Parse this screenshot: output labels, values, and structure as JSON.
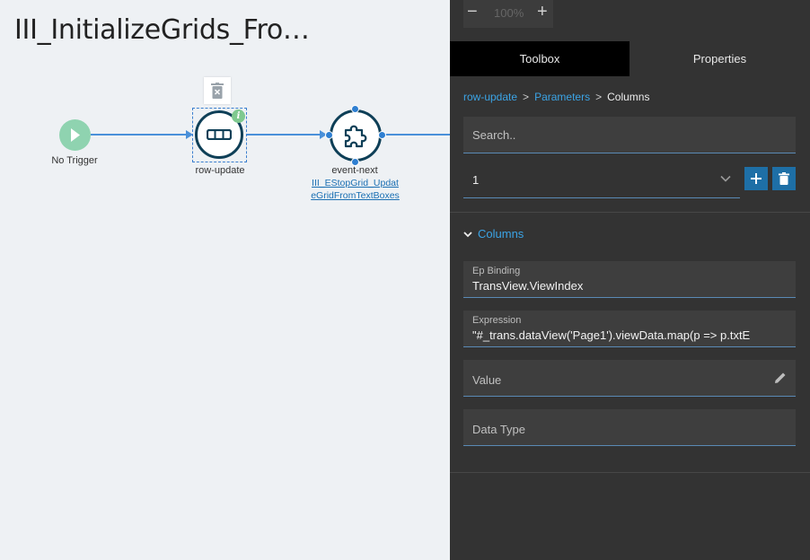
{
  "canvas": {
    "flow_title": "III_InitializeGrids_Fro…",
    "nodes": {
      "trigger_label": "No Trigger",
      "row_update_label": "row-update",
      "event_next_label": "event-next",
      "event_next_link": "III_EStopGrid_UpdateGridFromTextBoxes"
    }
  },
  "panel": {
    "zoom": {
      "minus": "−",
      "value": "100%",
      "plus": "+"
    },
    "tabs": [
      {
        "label": "Toolbox",
        "active": true
      },
      {
        "label": "Properties",
        "active": false
      }
    ],
    "breadcrumb": {
      "item1": "row-update",
      "item2": "Parameters",
      "current": "Columns",
      "separator": ">"
    },
    "search": {
      "placeholder": "Search.."
    },
    "selector": {
      "value": "1"
    },
    "section": {
      "title": "Columns",
      "expanded": true
    },
    "fields": {
      "ep_binding": {
        "label": "Ep Binding",
        "value": "TransView.ViewIndex"
      },
      "expression": {
        "label": "Expression",
        "value": "\"#_trans.dataView('Page1').viewData.map(p => p.txtE"
      },
      "value": {
        "placeholder": "Value"
      },
      "data_type": {
        "placeholder": "Data Type"
      }
    }
  },
  "colors": {
    "panel_bg": "#333333",
    "accent": "#3ba4e6",
    "node_stroke": "#0e3f57",
    "connector": "#4a90d9",
    "trigger": "#8fd3b0",
    "action_button": "#1e6fa6"
  },
  "icons": [
    "play-icon",
    "trash-icon",
    "info-icon",
    "row-update-icon",
    "puzzle-icon",
    "chevron-down-icon",
    "plus-icon",
    "delete-icon",
    "edit-icon"
  ]
}
